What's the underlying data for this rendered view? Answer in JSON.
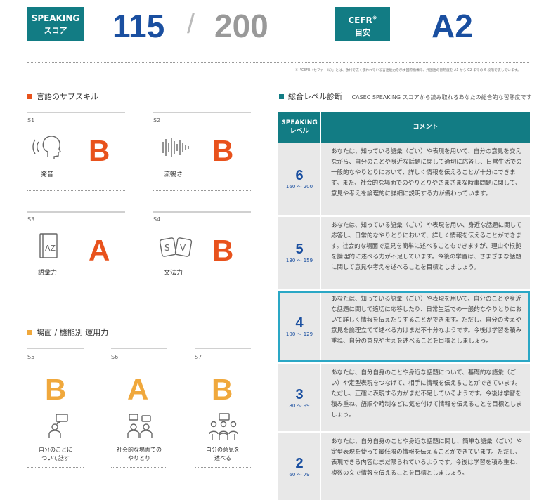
{
  "header": {
    "speaking_label_1": "SPEAKING",
    "speaking_label_2": "スコア",
    "score": "115",
    "slash": "/",
    "max_score": "200",
    "cefr_label_1": "CEFR",
    "cefr_mark": "※",
    "cefr_label_2": "目安",
    "cefr_level": "A2",
    "footnote": "※「CEFR（セファール）」とは、欧州で広く使われている言語能力を示す国際指標で、外国語の習熟度を A1 から C2 までの 6 段階で表しています。"
  },
  "subskills": {
    "title": "言語のサブスキル",
    "items": [
      {
        "code": "S1",
        "name": "発音",
        "grade": "B"
      },
      {
        "code": "S2",
        "name": "流暢さ",
        "grade": "B"
      },
      {
        "code": "S3",
        "name": "語彙力",
        "grade": "A"
      },
      {
        "code": "S4",
        "name": "文法力",
        "grade": "B"
      }
    ]
  },
  "functional": {
    "title": "場面 / 機能別 運用力",
    "items": [
      {
        "code": "S5",
        "grade": "B",
        "name_1": "自分のことに",
        "name_2": "ついて話す"
      },
      {
        "code": "S6",
        "grade": "A",
        "name_1": "社会的な場面での",
        "name_2": "やりとり"
      },
      {
        "code": "S7",
        "grade": "B",
        "name_1": "自分の意見を",
        "name_2": "述べる"
      }
    ]
  },
  "diagnosis": {
    "title": "総合レベル診断",
    "subtitle": "CASEC SPEAKING スコアから読み取れるあなたの総合的な習熟度です",
    "col_level_1": "SPEAKING",
    "col_level_2": "レベル",
    "col_comment": "コメント",
    "rows": [
      {
        "level": "6",
        "range": "160 〜 200",
        "comment": "あなたは、知っている語彙（ごい）や表現を用いて、自分の意見を交えながら、自分のことや身近な話題に関して適切に応答し、日常生活での一般的なやりとりにおいて、詳しく情報を伝えることが十分にできます。また、社会的な場面でのやりとりやさまざまな時事問題に関して、意見や考えを論理的に詳細に説明する力が備わっています。"
      },
      {
        "level": "5",
        "range": "130 〜 159",
        "comment": "あなたは、知っている語彙（ごい）や表現を用い、身近な話題に関して応答し、日常的なやりとりにおいて、詳しく情報を伝えることができます。社会的な場面で意見を簡単に述べることもできますが、理由や根拠を論理的に述べる力が不足しています。今後の学習は、さまざまな話題に関して意見や考えを述べることを目標としましょう。"
      },
      {
        "level": "4",
        "range": "100 〜 129",
        "comment": "あなたは、知っている語彙（ごい）や表現を用いて、自分のことや身近な話題に関して適切に応答したり、日常生活での一般的なやりとりにおいて詳しく情報を伝えたりすることができます。ただし、自分の考えや意見を論理立てて述べる力はまだ不十分なようです。今後は学習を積み重ね、自分の意見や考えを述べることを目標としましょう。"
      },
      {
        "level": "3",
        "range": "80 〜 99",
        "comment": "あなたは、自分自身のことや身近な話題について、基礎的な語彙（ごい）や定型表現をつなげて、相手に情報を伝えることができています。ただし、正確に表現する力がまだ不足しているようです。今後は学習を積み重ね、語順や時制などに気を付けて情報を伝えることを目標としましょう。"
      },
      {
        "level": "2",
        "range": "60 〜 79",
        "comment": "あなたは、自分自身のことや身近な話題に関し、簡単な語彙（ごい）や定型表現を使って最低限の情報を伝えることができています。ただし、表現できる内容はまだ限られているようです。今後は学習を積み重ね、複数の文で情報を伝えることを目標としましょう。"
      }
    ]
  },
  "colors": {
    "teal": "#127c84",
    "score_blue": "#1a4fa0",
    "max_gray": "#999999",
    "grade_orange": "#e8521c",
    "grade_yellow": "#f0a83c",
    "highlight_border": "#2aa7c5"
  },
  "icons": [
    "speaking-head-icon",
    "waveform-icon",
    "dictionary-icon",
    "sv-cards-icon",
    "person-speech-icon",
    "two-people-icon",
    "group-discussion-icon"
  ]
}
